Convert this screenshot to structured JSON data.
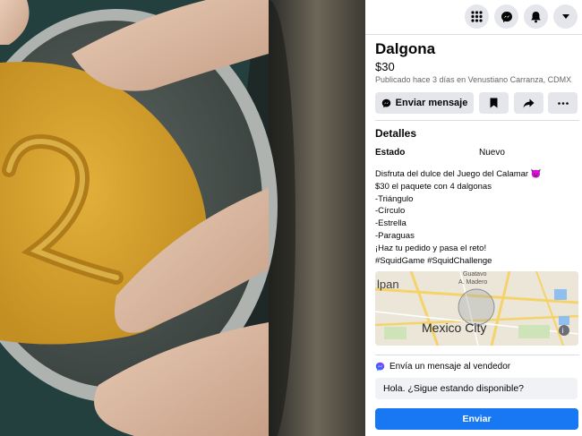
{
  "listing": {
    "title": "Dalgona",
    "price": "$30",
    "meta": "Publicado hace 3 días en Venustiano Carranza, CDMX",
    "actions": {
      "message_label": "Enviar mensaje",
      "save_icon": "bookmark-icon",
      "share_icon": "share-icon",
      "more_icon": "more-icon"
    },
    "details": {
      "heading": "Detalles",
      "condition_label": "Estado",
      "condition_value": "Nuevo"
    },
    "description": [
      "Disfruta del dulce del Juego del Calamar 😈",
      "$30 el paquete con 4 dalgonas",
      "-Triángulo",
      "-Círculo",
      "-Estrella",
      "-Paraguas",
      "¡Haz tu pedido y pasa el reto!",
      "#SquidGame #SquidChallenge"
    ],
    "map": {
      "labels": {
        "left": "lpan",
        "top1": "Guatavo",
        "top2": "A. Madero",
        "city": "Mexico City"
      }
    }
  },
  "topbar": {
    "icons": [
      "grid-menu-icon",
      "messenger-icon",
      "bell-icon",
      "caret-down-icon"
    ]
  },
  "contact": {
    "seller_label": "Envía un mensaje al vendedor",
    "message_value": "Hola. ¿Sigue estando disponible?",
    "send_label": "Enviar"
  },
  "colors": {
    "accent": "#1877f2",
    "button_gray": "#e4e6eb",
    "secondary_text": "#65676b"
  }
}
